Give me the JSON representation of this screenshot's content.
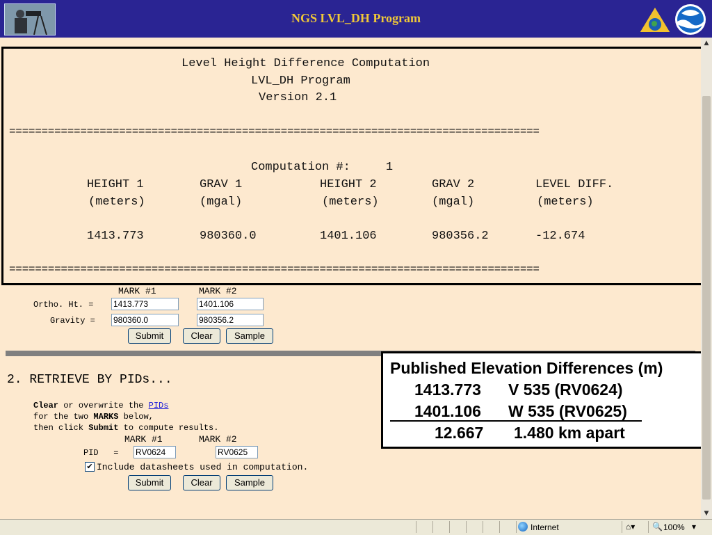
{
  "banner": {
    "title": "NGS LVL_DH Program"
  },
  "result": {
    "line1": "Level Height Difference Computation",
    "line2": "LVL_DH Program",
    "line3": "Version 2.1",
    "separator": "==================================================================================",
    "computation_label": "Computation #:     1",
    "headers": [
      "HEIGHT 1",
      "GRAV 1",
      "HEIGHT 2",
      "GRAV 2",
      "LEVEL DIFF."
    ],
    "units": [
      "(meters)",
      "(mgal)",
      "(meters)",
      "(mgal)",
      "(meters)"
    ],
    "values": [
      "1413.773",
      "980360.0",
      "1401.106",
      "980356.2",
      "-12.674"
    ]
  },
  "form1": {
    "mark1_label": "MARK #1",
    "mark2_label": "MARK #2",
    "ortho_label": "Ortho. Ht. =",
    "gravity_label": "Gravity =",
    "ortho1": "1413.773",
    "ortho2": "1401.106",
    "grav1": "980360.0",
    "grav2": "980356.2",
    "submit": "Submit",
    "clear": "Clear",
    "sample": "Sample"
  },
  "section2": {
    "title": "2. RETRIEVE BY PIDs...",
    "instr_clear": "Clear",
    "instr_1": " or overwrite the ",
    "instr_link": "PIDs",
    "instr_2": "for the two ",
    "instr_marks": "MARKS",
    "instr_3": " below,",
    "instr_4": "then click ",
    "instr_submit": "Submit",
    "instr_5": " to compute results.",
    "mark1_label": "MARK #1",
    "mark2_label": "MARK #2",
    "pid_label": "PID   =",
    "pid1": "RV0624",
    "pid2": "RV0625",
    "include_label": "Include datasheets used in computation.",
    "include_checked": true,
    "submit": "Submit",
    "clear": "Clear",
    "sample": "Sample"
  },
  "published": {
    "title": "Published Elevation Differences (m)",
    "row1_value": "1413.773",
    "row1_mark": "V 535 (RV0624)",
    "row2_value": "1401.106",
    "row2_mark": "W 535 (RV0625)",
    "diff_value": "12.667",
    "distance": "1.480 km apart"
  },
  "statusbar": {
    "zone": "Internet",
    "zoom": "100%"
  },
  "colors": {
    "banner_bg": "#2a2493",
    "banner_text": "#f0c838",
    "page_bg": "#fde9cf",
    "link": "#1a1adb"
  }
}
